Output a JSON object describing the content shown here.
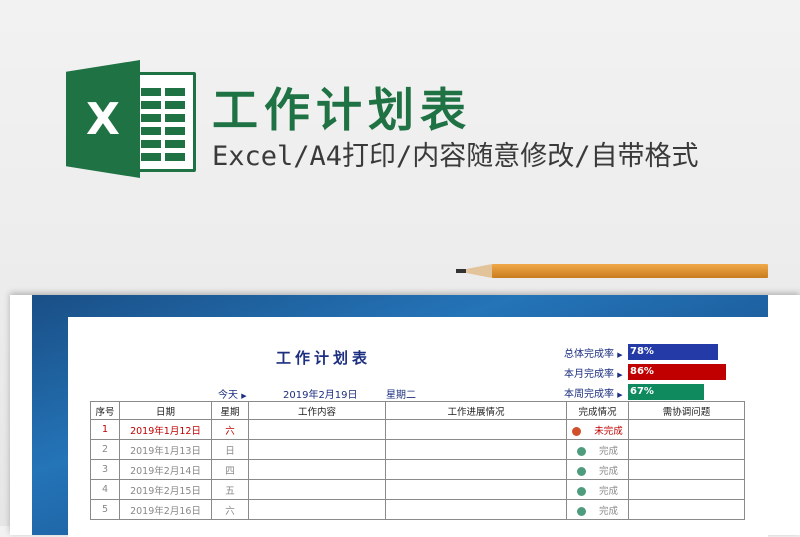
{
  "banner": {
    "logo_letter": "X",
    "logo_icon": "excel-icon",
    "title": "工作计划表",
    "subtitle": "Excel/A4打印/内容随意修改/自带格式"
  },
  "doc": {
    "title": "工作计划表",
    "rates": [
      {
        "label": "总体完成率",
        "value": "78%",
        "color": "#233aa7"
      },
      {
        "label": "本月完成率",
        "value": "86%",
        "color": "#c00000"
      },
      {
        "label": "本周完成率",
        "value": "67%",
        "color": "#0f8a5f"
      }
    ],
    "today_label": "今天",
    "today_date": "2019年2月19日",
    "today_weekday": "星期二",
    "columns": [
      "序号",
      "日期",
      "星期",
      "工作内容",
      "工作进展情况",
      "完成情况",
      "需协调问题"
    ],
    "rows": [
      {
        "no": "1",
        "date": "2019年1月12日",
        "weekday": "六",
        "content": "",
        "progress": "",
        "status": "未完成",
        "issue": ""
      },
      {
        "no": "2",
        "date": "2019年1月13日",
        "weekday": "日",
        "content": "",
        "progress": "",
        "status": "完成",
        "issue": ""
      },
      {
        "no": "3",
        "date": "2019年2月14日",
        "weekday": "四",
        "content": "",
        "progress": "",
        "status": "完成",
        "issue": ""
      },
      {
        "no": "4",
        "date": "2019年2月15日",
        "weekday": "五",
        "content": "",
        "progress": "",
        "status": "完成",
        "issue": ""
      },
      {
        "no": "5",
        "date": "2019年2月16日",
        "weekday": "六",
        "content": "",
        "progress": "",
        "status": "完成",
        "issue": ""
      }
    ]
  }
}
